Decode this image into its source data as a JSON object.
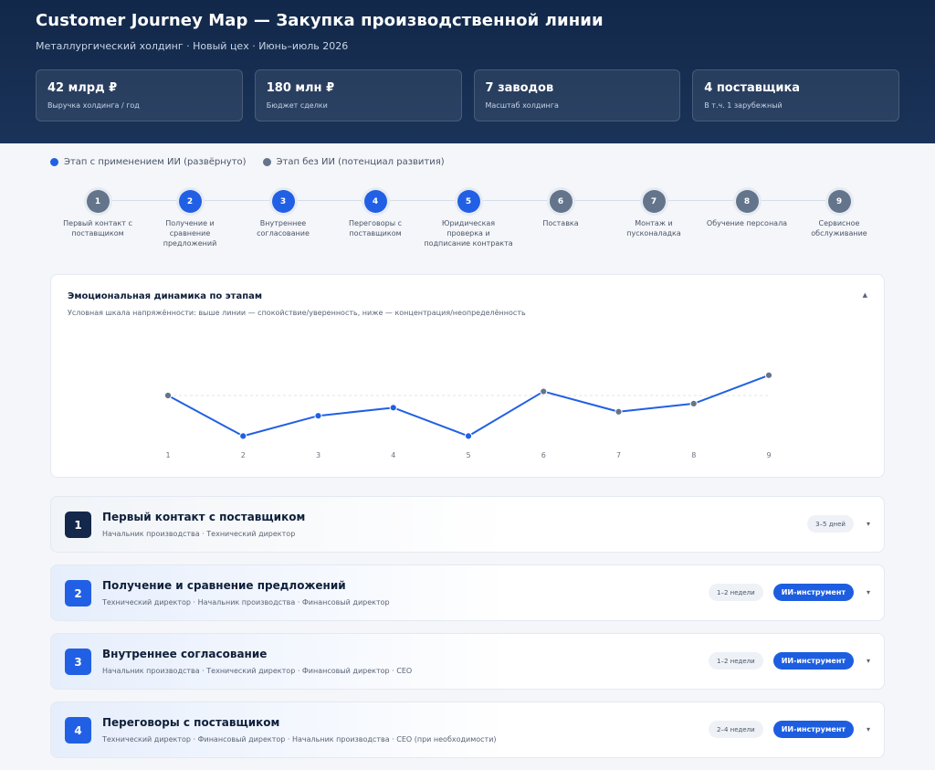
{
  "header": {
    "title": "Customer Journey Map — Закупка производственной линии",
    "subtitle": "Металлургический холдинг · Новый цех · Июнь–июль 2026",
    "kpis": [
      {
        "value": "42 млрд ₽",
        "label": "Выручка холдинга / год"
      },
      {
        "value": "180 млн ₽",
        "label": "Бюджет сделки"
      },
      {
        "value": "7 заводов",
        "label": "Масштаб холдинга"
      },
      {
        "value": "4 поставщика",
        "label": "В т.ч. 1 зарубежный"
      }
    ]
  },
  "legend": {
    "ai": "Этап с применением ИИ (развёрнуто)",
    "no_ai": "Этап без ИИ (потенциал развития)"
  },
  "colors": {
    "ai": "#2160e4",
    "no_ai": "#64748b",
    "dark": "#13284a"
  },
  "timeline": [
    {
      "num": "1",
      "label": "Первый контакт с поставщиком",
      "ai": false
    },
    {
      "num": "2",
      "label": "Получение и сравнение предложений",
      "ai": true
    },
    {
      "num": "3",
      "label": "Внутреннее согласование",
      "ai": true
    },
    {
      "num": "4",
      "label": "Переговоры с поставщиком",
      "ai": true
    },
    {
      "num": "5",
      "label": "Юридическая проверка и подписание контракта",
      "ai": true
    },
    {
      "num": "6",
      "label": "Поставка",
      "ai": false
    },
    {
      "num": "7",
      "label": "Монтаж и пусконаладка",
      "ai": false
    },
    {
      "num": "8",
      "label": "Обучение персонала",
      "ai": false
    },
    {
      "num": "9",
      "label": "Сервисное обслуживание",
      "ai": false
    }
  ],
  "chart": {
    "title": "Эмоциональная динамика по этапам",
    "subtitle": "Условная шкала напряжённости: выше линии — спокойствие/уверенность, ниже — концентрация/неопределённость",
    "toggle": "▲"
  },
  "chart_data": {
    "type": "line",
    "x": [
      "1",
      "2",
      "3",
      "4",
      "5",
      "6",
      "7",
      "8",
      "9"
    ],
    "values": [
      0,
      -2,
      -1,
      -0.6,
      -2,
      0.2,
      -0.8,
      -0.4,
      1
    ],
    "baseline": 0,
    "point_colors": [
      "#64748b",
      "#2160e4",
      "#2160e4",
      "#2160e4",
      "#2160e4",
      "#64748b",
      "#64748b",
      "#64748b",
      "#64748b"
    ],
    "line_color": "#2160e4",
    "grid": false
  },
  "stages": [
    {
      "num": "1",
      "title": "Первый контакт с поставщиком",
      "roles": "Начальник производства · Технический директор",
      "duration": "3–5 дней",
      "ai": false,
      "ai_label": ""
    },
    {
      "num": "2",
      "title": "Получение и сравнение предложений",
      "roles": "Технический директор · Начальник производства · Финансовый директор",
      "duration": "1–2 недели",
      "ai": true,
      "ai_label": "ИИ-инструмент"
    },
    {
      "num": "3",
      "title": "Внутреннее согласование",
      "roles": "Начальник производства · Технический директор · Финансовый директор · CEO",
      "duration": "1–2 недели",
      "ai": true,
      "ai_label": "ИИ-инструмент"
    },
    {
      "num": "4",
      "title": "Переговоры с поставщиком",
      "roles": "Технический директор · Финансовый директор · Начальник производства · CEO (при необходимости)",
      "duration": "2–4 недели",
      "ai": true,
      "ai_label": "ИИ-инструмент"
    }
  ],
  "chevron": "▾"
}
